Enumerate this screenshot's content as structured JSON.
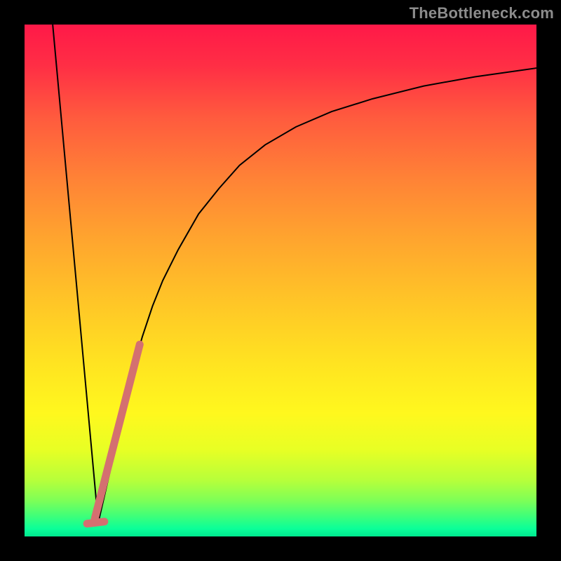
{
  "watermark": "TheBottleneck.com",
  "chart_data": {
    "type": "line",
    "title": "",
    "xlabel": "",
    "ylabel": "",
    "xlim": [
      0,
      100
    ],
    "ylim": [
      0,
      100
    ],
    "gradient": {
      "top_color": "#ff1948",
      "mid_color": "#ffe321",
      "bottom_color": "#00e88f"
    },
    "series": [
      {
        "name": "decreasing-line",
        "type": "line",
        "color": "#000000",
        "width": 2,
        "x": [
          5.5,
          14.4
        ],
        "y": [
          100,
          2.7
        ]
      },
      {
        "name": "increasing-curve",
        "type": "line",
        "color": "#000000",
        "width": 2,
        "x": [
          14.4,
          17,
          19,
          21,
          23,
          25,
          27,
          30,
          34,
          38,
          42,
          47,
          53,
          60,
          68,
          78,
          88,
          100
        ],
        "y": [
          2.7,
          14,
          24,
          32,
          39,
          45,
          50,
          56,
          63,
          68,
          72.5,
          76.5,
          80,
          83,
          85.5,
          88,
          89.8,
          91.5
        ]
      },
      {
        "name": "highlighted-segment",
        "type": "line",
        "color": "#d47070",
        "width": 11,
        "x": [
          13.7,
          22.5
        ],
        "y": [
          3.4,
          37.5
        ]
      },
      {
        "name": "min-marker",
        "type": "line",
        "color": "#d47070",
        "width": 11,
        "x": [
          12.2,
          15.6
        ],
        "y": [
          2.5,
          2.9
        ]
      }
    ]
  }
}
